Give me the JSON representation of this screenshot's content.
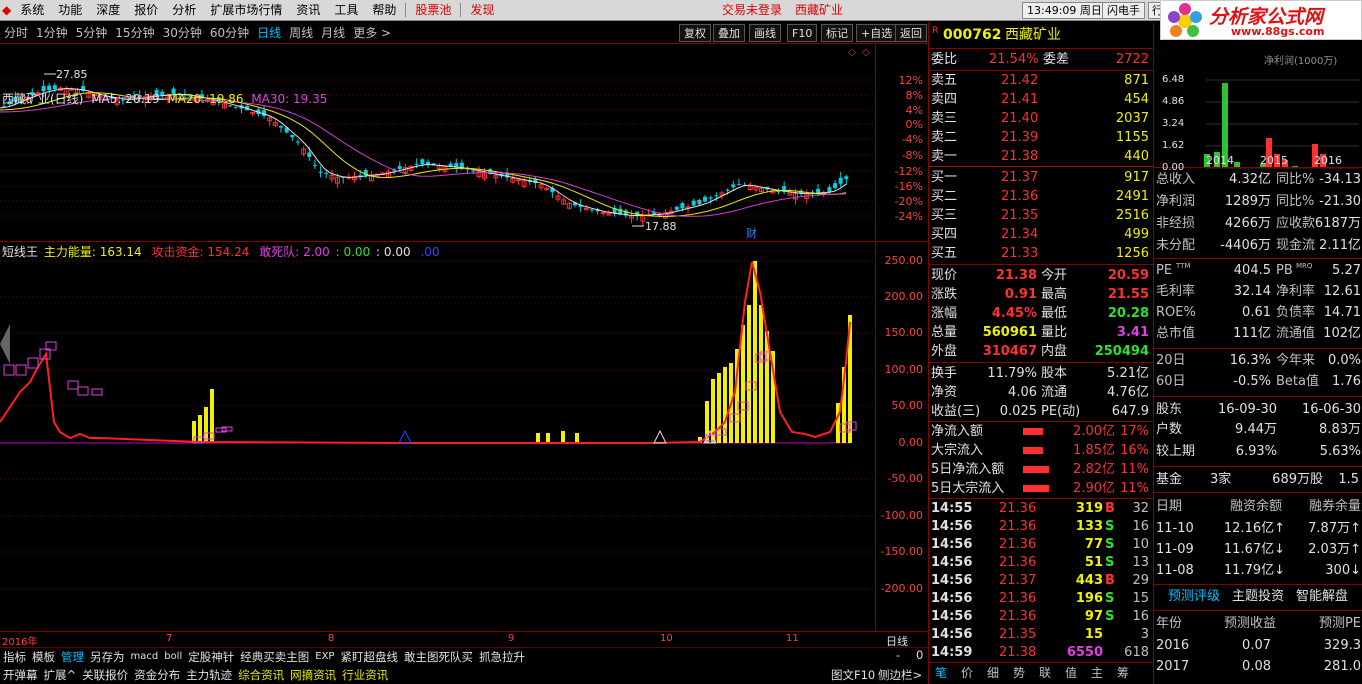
{
  "menu": {
    "items": [
      "系统",
      "功能",
      "深度",
      "报价",
      "分析",
      "扩展市场行情",
      "资讯",
      "工具",
      "帮助"
    ],
    "stock_pool": "股票池",
    "discover": "发现",
    "trade_status": "交易未登录",
    "stock_name": "西藏矿业",
    "clock": "13:49:09 周日",
    "flash": "闪电手",
    "hang": "行"
  },
  "logo": {
    "title": "分析家公式网",
    "url": "www.88gs.com"
  },
  "timeframes": [
    "分时",
    "1分钟",
    "5分钟",
    "15分钟",
    "30分钟",
    "60分钟",
    "日线",
    "周线",
    "月线",
    "更多 >"
  ],
  "toolbar": [
    "复权",
    "叠加",
    "画线",
    "F10",
    "标记",
    "+自选",
    "返回"
  ],
  "kline": {
    "title": "西藏矿业(日线)",
    "ma5": "MA5: 20.19",
    "ma20": "MA20: 19.86",
    "ma30": "MA30: 19.35",
    "high_label": "27.85",
    "low_label": "17.88",
    "cai": "财",
    "pct_labels": [
      "12%",
      "8%",
      "4%",
      "0%",
      "-4%",
      "-8%",
      "-12%",
      "-16%",
      "-20%",
      "-24%"
    ]
  },
  "indicator": {
    "name": "短线王",
    "main_force": "主力能量: 163.14",
    "attack": "攻击资金: 154.24",
    "dare": "敢死队: 2.00",
    "v1": ": 0.00",
    "v2": ": 0.00",
    "v3": ".00",
    "labels": [
      "250.00",
      "200.00",
      "150.00",
      "100.00",
      "50.00",
      "0.00",
      "-50.00",
      "-100.00",
      "-150.00",
      "-200.00"
    ]
  },
  "dates": {
    "year": "2016年",
    "marks": [
      "7",
      "8",
      "9",
      "10",
      "11"
    ],
    "period": "日线"
  },
  "bottom1": [
    "指标",
    "模板",
    "管理",
    "另存为",
    "macd",
    "boll",
    "定股神针",
    "经典买卖主图",
    "EXP",
    "紧盯超盘线",
    "敢主图死队买",
    "抓急拉升"
  ],
  "bottom2": [
    "开弹幕",
    "扩展^",
    "关联报价",
    "资金分布",
    "主力轨迹",
    "综合资讯",
    "网摘资讯",
    "行业资讯"
  ],
  "bottom_right": {
    "tuwen": "图文F10",
    "side": "侧边栏>",
    "page": "-",
    "zero": "0"
  },
  "quote": {
    "r": "R",
    "code": "000762",
    "name": "西藏矿业",
    "weibi": {
      "label": "委比",
      "pct": "21.54%",
      "wc_label": "委差",
      "wc": "2722"
    },
    "sell": [
      {
        "l": "卖五",
        "p": "21.42",
        "v": "871"
      },
      {
        "l": "卖四",
        "p": "21.41",
        "v": "454"
      },
      {
        "l": "卖三",
        "p": "21.40",
        "v": "2037"
      },
      {
        "l": "卖二",
        "p": "21.39",
        "v": "1155"
      },
      {
        "l": "卖一",
        "p": "21.38",
        "v": "440"
      }
    ],
    "buy": [
      {
        "l": "买一",
        "p": "21.37",
        "v": "917"
      },
      {
        "l": "买二",
        "p": "21.36",
        "v": "2491"
      },
      {
        "l": "买三",
        "p": "21.35",
        "v": "2516"
      },
      {
        "l": "买四",
        "p": "21.34",
        "v": "499"
      },
      {
        "l": "买五",
        "p": "21.33",
        "v": "1256"
      }
    ],
    "stats": [
      {
        "l1": "现价",
        "v1": "21.38",
        "l2": "今开",
        "v2": "20.59"
      },
      {
        "l1": "涨跌",
        "v1": "0.91",
        "l2": "最高",
        "v2": "21.55"
      },
      {
        "l1": "涨幅",
        "v1": "4.45%",
        "l2": "最低",
        "v2": "20.28"
      },
      {
        "l1": "总量",
        "v1": "560961",
        "l2": "量比",
        "v2": "3.41"
      },
      {
        "l1": "外盘",
        "v1": "310467",
        "l2": "内盘",
        "v2": "250494"
      }
    ],
    "stats2": [
      {
        "l1": "换手",
        "v1": "11.79%",
        "l2": "股本",
        "v2": "5.21亿"
      },
      {
        "l1": "净资",
        "v1": "4.06",
        "l2": "流通",
        "v2": "4.76亿"
      },
      {
        "l1": "收益(三)",
        "v1": "0.025",
        "l2": "PE(动)",
        "v2": "647.9"
      }
    ],
    "flow": [
      {
        "l": "净流入额",
        "v": "2.00亿",
        "p": "17%"
      },
      {
        "l": "大宗流入",
        "v": "1.85亿",
        "p": "16%"
      },
      {
        "l": "5日净流入额",
        "v": "2.82亿",
        "p": "11%"
      },
      {
        "l": "5日大宗流入",
        "v": "2.90亿",
        "p": "11%"
      }
    ],
    "ticks": [
      {
        "t": "14:55",
        "p": "21.36",
        "v": "319",
        "s": "B",
        "n": "32"
      },
      {
        "t": "14:56",
        "p": "21.36",
        "v": "133",
        "s": "S",
        "n": "16"
      },
      {
        "t": "14:56",
        "p": "21.36",
        "v": "77",
        "s": "S",
        "n": "10"
      },
      {
        "t": "14:56",
        "p": "21.36",
        "v": "51",
        "s": "S",
        "n": "13"
      },
      {
        "t": "14:56",
        "p": "21.37",
        "v": "443",
        "s": "B",
        "n": "29"
      },
      {
        "t": "14:56",
        "p": "21.36",
        "v": "196",
        "s": "S",
        "n": "15"
      },
      {
        "t": "14:56",
        "p": "21.36",
        "v": "97",
        "s": "S",
        "n": "16"
      },
      {
        "t": "14:56",
        "p": "21.35",
        "v": "15",
        "s": "",
        "n": "3"
      },
      {
        "t": "14:59",
        "p": "21.38",
        "v": "6550",
        "s": "",
        "n": "618"
      }
    ],
    "tabs": [
      "笔",
      "价",
      "细",
      "势",
      "联",
      "值",
      "主",
      "筹"
    ]
  },
  "f10": {
    "chart_title": "净利润(1000万)",
    "chart_y": [
      "6.48",
      "4.86",
      "3.24",
      "1.62",
      "0.00"
    ],
    "years": [
      "2014",
      "2015",
      "2016"
    ],
    "rows1": [
      {
        "l1": "总收入",
        "v1": "4.32亿",
        "l2": "同比%",
        "v2": "-34.13"
      },
      {
        "l1": "净利润",
        "v1": "1289万",
        "l2": "同比%",
        "v2": "-21.30"
      },
      {
        "l1": "非经损",
        "v1": "4266万",
        "l2": "应收款",
        "v2": "6187万"
      },
      {
        "l1": "未分配",
        "v1": "-4406万",
        "l2": "现金流",
        "v2": "2.11亿"
      }
    ],
    "rows2": [
      {
        "l1": "PE",
        "sup1": "TTM",
        "v1": "404.5",
        "l2": "PB",
        "sup2": "MRQ",
        "v2": "5.27"
      },
      {
        "l1": "毛利率",
        "sup1": "",
        "v1": "32.14",
        "l2": "净利率",
        "sup2": "",
        "v2": "12.61"
      },
      {
        "l1": "ROE%",
        "sup1": "",
        "v1": "0.61",
        "l2": "负债率",
        "sup2": "",
        "v2": "14.71"
      },
      {
        "l1": "总市值",
        "sup1": "",
        "v1": "111亿",
        "l2": "流通值",
        "sup2": "",
        "v2": "102亿"
      }
    ],
    "rows3": [
      {
        "l1": "20日",
        "v1": "16.3%",
        "l2": "今年来",
        "v2": "0.0%"
      },
      {
        "l1": "60日",
        "v1": "-0.5%",
        "l2": "Beta值",
        "v2": "1.76"
      }
    ],
    "holders": {
      "label": "股东",
      "d1": "16-09-30",
      "d2": "16-06-30",
      "hu": "户数",
      "hu1": "9.44万",
      "hu2": "8.83万",
      "jsy": "较上期",
      "j1": "6.93%",
      "j2": "5.63%"
    },
    "fund": {
      "label": "基金",
      "count": "3家",
      "amount": "689万股",
      "v": "1.5"
    },
    "margin": {
      "h1": "日期",
      "h2": "融资余额",
      "h3": "融券余量",
      "rows": [
        {
          "d": "11-10",
          "a": "12.16亿↑",
          "b": "7.87万↑"
        },
        {
          "d": "11-09",
          "a": "11.67亿↓",
          "b": "2.03万↑"
        },
        {
          "d": "11-08",
          "a": "11.79亿↓",
          "b": "300↓"
        }
      ]
    },
    "tabs": [
      "预测评级",
      "主题投资",
      "智能解盘"
    ],
    "forecast": {
      "h1": "年份",
      "h2": "预测收益",
      "h3": "预测PE",
      "rows": [
        {
          "y": "2016",
          "e": "0.07",
          "pe": "329.3"
        },
        {
          "y": "2017",
          "e": "0.08",
          "pe": "281.0"
        }
      ]
    }
  }
}
